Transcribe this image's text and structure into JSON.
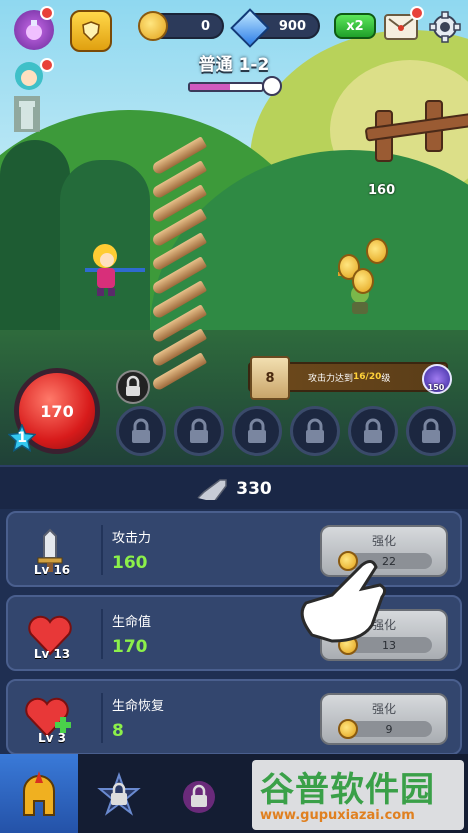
{
  "hud": {
    "coins": "0",
    "gems": "900",
    "speed": "x2",
    "stage": "普通 1-2",
    "stage_progress": 0.55
  },
  "battle": {
    "damage_popup": "160",
    "hp": "170",
    "hero_level": "1"
  },
  "quest": {
    "number": "8",
    "text_prefix": "攻击力达到 ",
    "progress": "16/20",
    "text_suffix": " 级",
    "reward": "150"
  },
  "power": {
    "value": "330"
  },
  "upgrades": [
    {
      "name": "攻击力",
      "level": "Lv 16",
      "value": "160",
      "button": "强化",
      "cost": "22"
    },
    {
      "name": "生命值",
      "level": "Lv 13",
      "value": "170",
      "button": "强化",
      "cost": "13"
    },
    {
      "name": "生命恢复",
      "level": "Lv 3",
      "value": "8",
      "button": "强化",
      "cost": "9"
    }
  ],
  "watermark": {
    "name": "谷普软件园",
    "url": "www.gupuxiazai.com"
  },
  "colors": {
    "accent": "#3a7ad8",
    "stat_value": "#8cf04a",
    "hp": "#d81b1b"
  }
}
